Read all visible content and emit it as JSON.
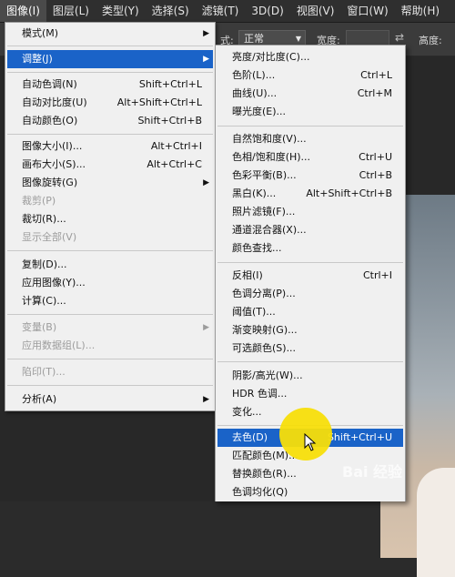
{
  "menubar": {
    "items": [
      {
        "label": "图像(I)",
        "active": true
      },
      {
        "label": "图层(L)"
      },
      {
        "label": "类型(Y)"
      },
      {
        "label": "选择(S)"
      },
      {
        "label": "滤镜(T)"
      },
      {
        "label": "3D(D)"
      },
      {
        "label": "视图(V)"
      },
      {
        "label": "窗口(W)"
      },
      {
        "label": "帮助(H)"
      }
    ]
  },
  "options": {
    "mode_label": "式:",
    "mode_value": "正常",
    "width_label": "宽度:",
    "height_label": "高度:"
  },
  "image_menu": {
    "items": [
      {
        "label": "模式(M)",
        "submenu": true
      },
      {
        "label": "调整(J)",
        "submenu": true,
        "highlight": true
      },
      {
        "label": "自动色调(N)",
        "shortcut": "Shift+Ctrl+L"
      },
      {
        "label": "自动对比度(U)",
        "shortcut": "Alt+Shift+Ctrl+L"
      },
      {
        "label": "自动颜色(O)",
        "shortcut": "Shift+Ctrl+B"
      },
      {
        "label": "图像大小(I)...",
        "shortcut": "Alt+Ctrl+I"
      },
      {
        "label": "画布大小(S)...",
        "shortcut": "Alt+Ctrl+C"
      },
      {
        "label": "图像旋转(G)",
        "submenu": true
      },
      {
        "label": "裁剪(P)",
        "disabled": true
      },
      {
        "label": "裁切(R)..."
      },
      {
        "label": "显示全部(V)",
        "disabled": true
      },
      {
        "label": "复制(D)..."
      },
      {
        "label": "应用图像(Y)..."
      },
      {
        "label": "计算(C)..."
      },
      {
        "label": "变量(B)",
        "submenu": true,
        "disabled": true
      },
      {
        "label": "应用数据组(L)...",
        "disabled": true
      },
      {
        "label": "陷印(T)...",
        "disabled": true
      },
      {
        "label": "分析(A)",
        "submenu": true
      }
    ]
  },
  "adjust_menu": {
    "items": [
      {
        "label": "亮度/对比度(C)..."
      },
      {
        "label": "色阶(L)...",
        "shortcut": "Ctrl+L"
      },
      {
        "label": "曲线(U)...",
        "shortcut": "Ctrl+M"
      },
      {
        "label": "曝光度(E)..."
      },
      {
        "label": "自然饱和度(V)..."
      },
      {
        "label": "色相/饱和度(H)...",
        "shortcut": "Ctrl+U"
      },
      {
        "label": "色彩平衡(B)...",
        "shortcut": "Ctrl+B"
      },
      {
        "label": "黑白(K)...",
        "shortcut": "Alt+Shift+Ctrl+B"
      },
      {
        "label": "照片滤镜(F)..."
      },
      {
        "label": "通道混合器(X)..."
      },
      {
        "label": "颜色查找..."
      },
      {
        "label": "反相(I)",
        "shortcut": "Ctrl+I"
      },
      {
        "label": "色调分离(P)..."
      },
      {
        "label": "阈值(T)..."
      },
      {
        "label": "渐变映射(G)..."
      },
      {
        "label": "可选颜色(S)..."
      },
      {
        "label": "阴影/高光(W)..."
      },
      {
        "label": "HDR 色调..."
      },
      {
        "label": "变化..."
      },
      {
        "label": "去色(D)",
        "shortcut": "Shift+Ctrl+U",
        "highlight": true
      },
      {
        "label": "匹配颜色(M)..."
      },
      {
        "label": "替换颜色(R)..."
      },
      {
        "label": "色调均化(Q)"
      }
    ]
  },
  "watermark": "Bai 经验",
  "colors": {
    "highlight": "#1a63c8",
    "menu_bg": "#f0f0f0",
    "cursor_ring": "#f7de0a"
  }
}
